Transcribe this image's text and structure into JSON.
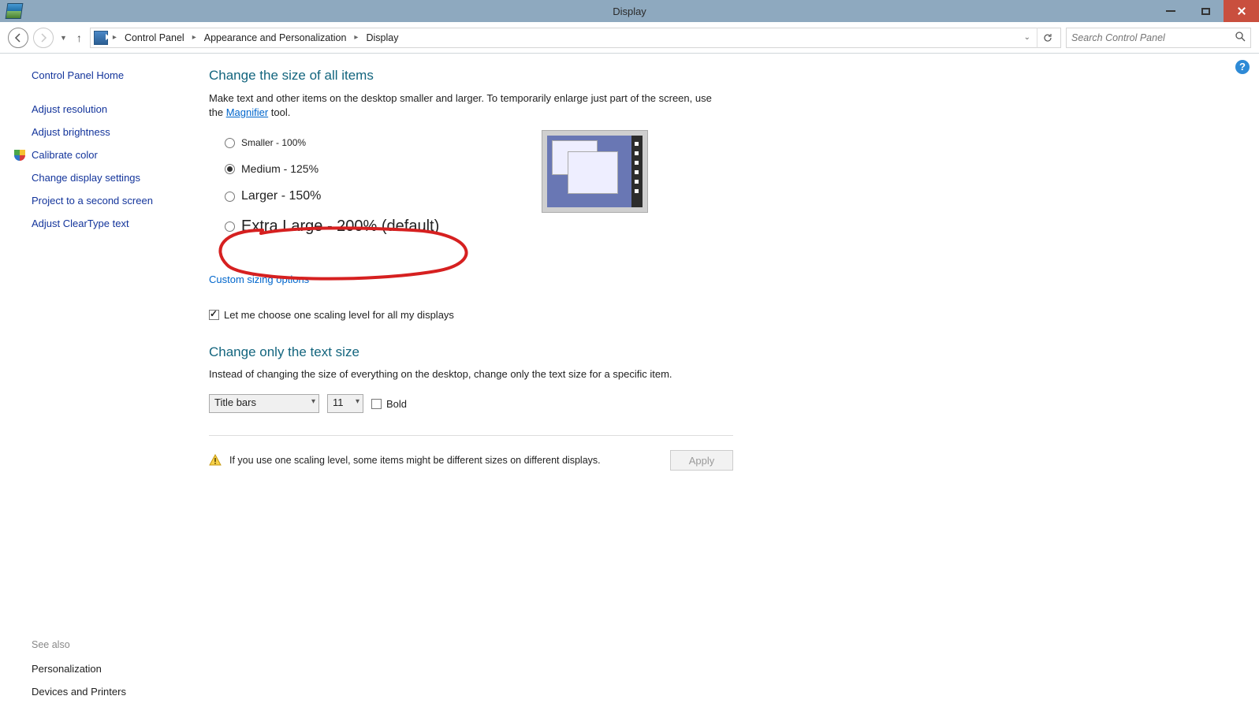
{
  "window": {
    "title": "Display"
  },
  "breadcrumbs": [
    "Control Panel",
    "Appearance and Personalization",
    "Display"
  ],
  "search": {
    "placeholder": "Search Control Panel"
  },
  "sidebar": {
    "home": "Control Panel Home",
    "links": [
      "Adjust resolution",
      "Adjust brightness",
      "Calibrate color",
      "Change display settings",
      "Project to a second screen",
      "Adjust ClearType text"
    ],
    "see_also_heading": "See also",
    "related": [
      "Personalization",
      "Devices and Printers"
    ]
  },
  "main": {
    "heading1": "Change the size of all items",
    "desc_pre": "Make text and other items on the desktop smaller and larger. To temporarily enlarge just part of the screen, use the ",
    "magnifier_link": "Magnifier",
    "desc_post": " tool.",
    "radios": [
      {
        "label": "Smaller - 100%",
        "selected": false
      },
      {
        "label": "Medium - 125%",
        "selected": true
      },
      {
        "label": "Larger - 150%",
        "selected": false
      },
      {
        "label": "Extra Large - 200% (default)",
        "selected": false
      }
    ],
    "custom_sizing": "Custom sizing options",
    "checkbox_label": "Let me choose one scaling level for all my displays",
    "checkbox_checked": true,
    "heading2": "Change only the text size",
    "desc2": "Instead of changing the size of everything on the desktop, change only the text size for a specific item.",
    "item_select": "Title bars",
    "size_select": "11",
    "bold_label": "Bold",
    "bold_checked": false,
    "warning_text": "If you use one scaling level, some items might be different sizes on different displays.",
    "apply_label": "Apply"
  }
}
